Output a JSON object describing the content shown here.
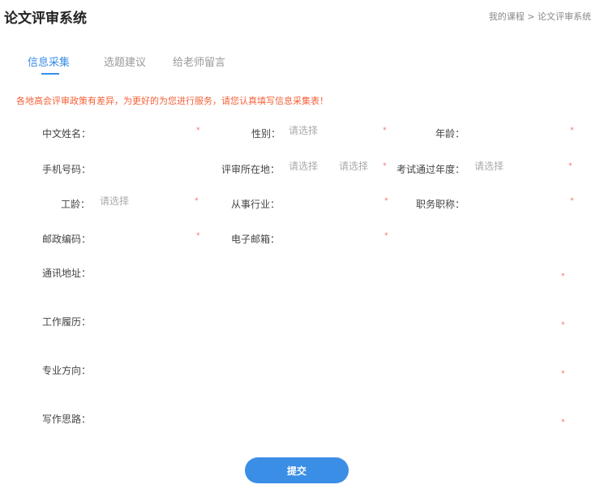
{
  "header": {
    "title": "论文评审系统",
    "breadcrumb": "我的课程 > 论文评审系统"
  },
  "tabs": [
    {
      "label": "信息采集"
    },
    {
      "label": "选题建议"
    },
    {
      "label": "给老师留言"
    }
  ],
  "notice": "各地高会评审政策有差异，为更好的为您进行服务，请您认真填写信息采集表！",
  "form": {
    "name": "中文姓名：",
    "gender": "性别：",
    "age": "年龄：",
    "phone": "手机号码：",
    "region": "评审所在地：",
    "exam_year": "考试通过年度：",
    "work_years": "工龄：",
    "industry": "从事行业：",
    "position": "职务职称：",
    "postcode": "邮政编码：",
    "email": "电子邮箱：",
    "address": "通讯地址：",
    "resume": "工作履历：",
    "major": "专业方向：",
    "idea": "写作思路：",
    "placeholder": "请选择",
    "required": "*"
  },
  "submit": "提交"
}
